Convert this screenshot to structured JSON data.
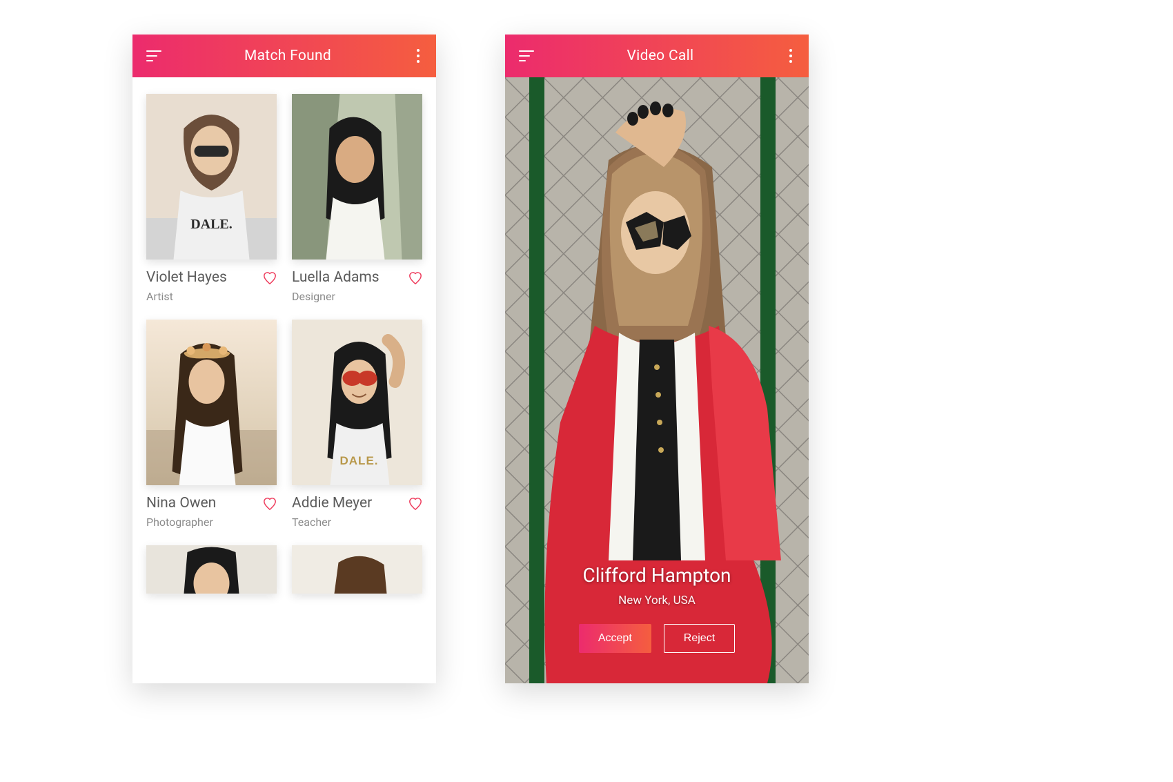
{
  "left": {
    "title": "Match Found",
    "matches": [
      {
        "name": "Violet Hayes",
        "role": "Artist"
      },
      {
        "name": "Luella Adams",
        "role": "Designer"
      },
      {
        "name": "Nina Owen",
        "role": "Photographer"
      },
      {
        "name": "Addie Meyer",
        "role": "Teacher"
      }
    ]
  },
  "right": {
    "title": "Video Call",
    "caller": {
      "name": "Clifford Hampton",
      "location": "New York, USA"
    },
    "accept_label": "Accept",
    "reject_label": "Reject"
  },
  "colors": {
    "gradient_start": "#ec2b6d",
    "gradient_end": "#f55e3f",
    "heart": "#ee3a5b"
  }
}
